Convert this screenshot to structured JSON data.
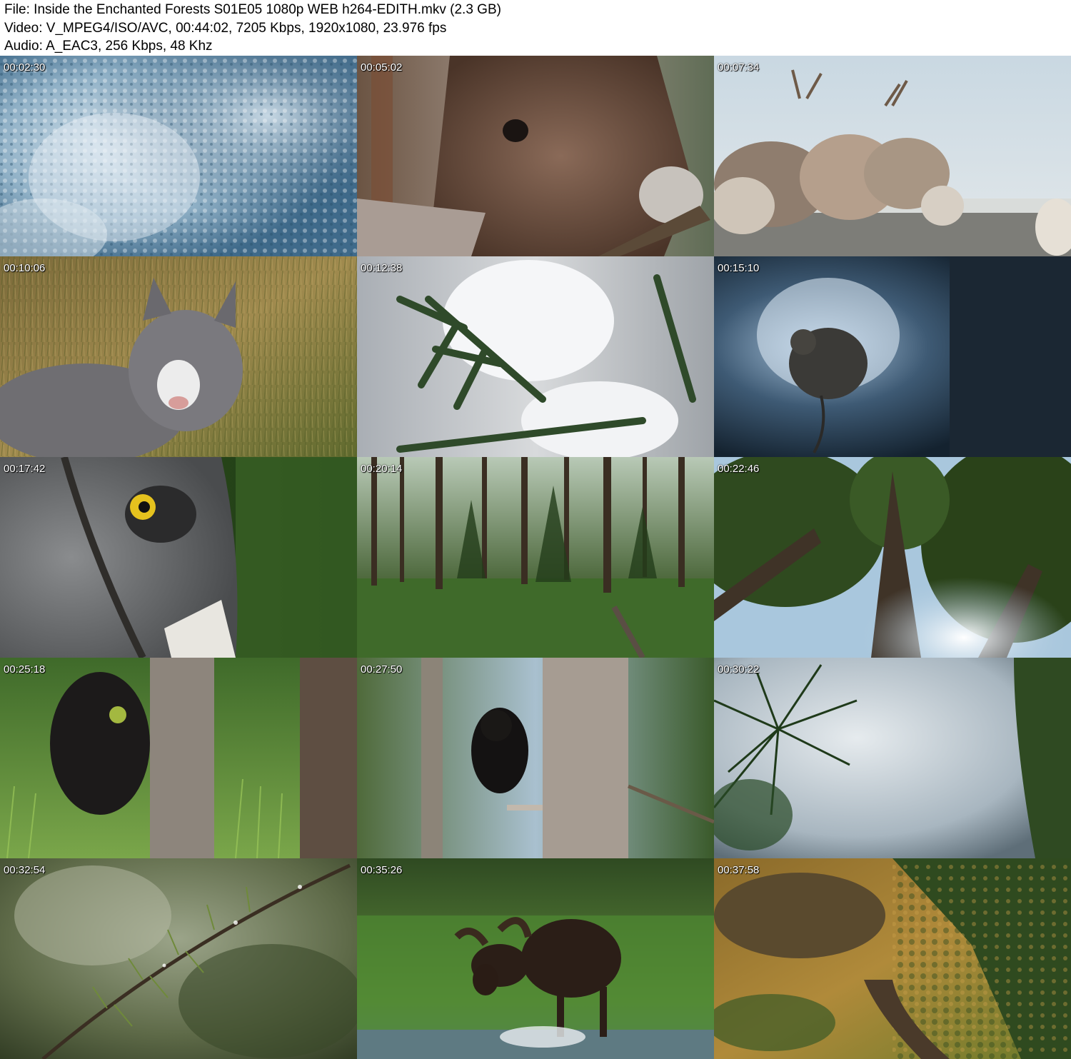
{
  "header": {
    "file_line": "File: Inside the Enchanted Forests S01E05 1080p WEB h264-EDITH.mkv (2.3 GB)",
    "video_line": "Video: V_MPEG4/ISO/AVC, 00:44:02, 7205 Kbps, 1920x1080, 23.976 fps",
    "audio_line": "Audio: A_EAC3, 256 Kbps, 48 Khz"
  },
  "thumbnails": [
    {
      "timestamp": "00:02:30"
    },
    {
      "timestamp": "00:05:02"
    },
    {
      "timestamp": "00:07:34"
    },
    {
      "timestamp": "00:10:06"
    },
    {
      "timestamp": "00:12:38"
    },
    {
      "timestamp": "00:15:10"
    },
    {
      "timestamp": "00:17:42"
    },
    {
      "timestamp": "00:20:14"
    },
    {
      "timestamp": "00:22:46"
    },
    {
      "timestamp": "00:25:18"
    },
    {
      "timestamp": "00:27:50"
    },
    {
      "timestamp": "00:30:22"
    },
    {
      "timestamp": "00:32:54"
    },
    {
      "timestamp": "00:35:26"
    },
    {
      "timestamp": "00:37:58"
    }
  ]
}
